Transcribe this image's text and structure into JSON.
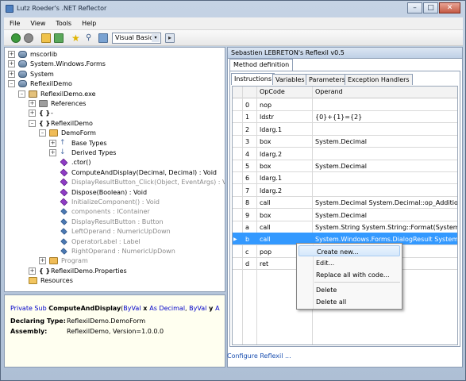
{
  "window": {
    "title": "Lutz Roeder's .NET Reflector",
    "min": "–",
    "max": "□",
    "close": "✕"
  },
  "menu": [
    "File",
    "View",
    "Tools",
    "Help"
  ],
  "toolbar": {
    "language": "Visual Basic",
    "go": "▸",
    "arrow": "▾"
  },
  "tree": [
    {
      "exp": "+",
      "icon": "asm",
      "label": "mscorlib",
      "gray": false
    },
    {
      "exp": "+",
      "icon": "asm",
      "label": "System.Windows.Forms",
      "gray": false
    },
    {
      "exp": "+",
      "icon": "asm",
      "label": "System",
      "gray": false
    },
    {
      "exp": "–",
      "icon": "asm",
      "label": "ReflexilDemo",
      "gray": false
    },
    {
      "exp": "–",
      "icon": "file",
      "label": "ReflexilDemo.exe",
      "gray": false
    },
    {
      "exp": "+",
      "icon": "refs",
      "label": "References",
      "gray": false
    },
    {
      "exp": "+",
      "icon": "ns",
      "label": "-",
      "gray": false
    },
    {
      "exp": "–",
      "icon": "ns",
      "label": "ReflexilDemo",
      "gray": false
    },
    {
      "exp": "–",
      "icon": "cls",
      "label": "DemoForm",
      "gray": false
    },
    {
      "exp": "+",
      "icon": "base",
      "label": "Base Types",
      "gray": false
    },
    {
      "exp": "+",
      "icon": "derived",
      "label": "Derived Types",
      "gray": false
    },
    {
      "exp": "",
      "icon": "method",
      "label": ".ctor()",
      "gray": false
    },
    {
      "exp": "",
      "icon": "method",
      "label": "ComputeAndDisplay(Decimal, Decimal) : Void",
      "gray": false
    },
    {
      "exp": "",
      "icon": "method",
      "label": "DisplayResultButton_Click(Object, EventArgs) : Void",
      "gray": true
    },
    {
      "exp": "",
      "icon": "method",
      "label": "Dispose(Boolean) : Void",
      "gray": false
    },
    {
      "exp": "",
      "icon": "method",
      "label": "InitializeComponent() : Void",
      "gray": true
    },
    {
      "exp": "",
      "icon": "field",
      "label": "components : IContainer",
      "gray": true
    },
    {
      "exp": "",
      "icon": "field",
      "label": "DisplayResultButton : Button",
      "gray": true
    },
    {
      "exp": "",
      "icon": "field",
      "label": "LeftOperand : NumericUpDown",
      "gray": true
    },
    {
      "exp": "",
      "icon": "field",
      "label": "OperatorLabel : Label",
      "gray": true
    },
    {
      "exp": "",
      "icon": "field",
      "label": "RightOperand : NumericUpDown",
      "gray": true
    },
    {
      "exp": "+",
      "icon": "cls",
      "label": "Program",
      "gray": true
    },
    {
      "exp": "+",
      "icon": "ns",
      "label": "ReflexilDemo.Properties",
      "gray": false
    },
    {
      "exp": "",
      "icon": "folder",
      "label": "Resources",
      "gray": false
    }
  ],
  "disasm": {
    "kw1": "Private Sub ",
    "name": "ComputeAndDisplay",
    "p1": "(",
    "kw2": "ByVal",
    "x": " x ",
    "kw3": "As Decimal",
    "sep": ", ",
    "kw4": "ByVal",
    "y": " y ",
    "kw5": "A",
    "declaring_label": "Declaring Type:",
    "declaring_value": "ReflexilDemo.DemoForm",
    "assembly_label": "Assembly:",
    "assembly_value": "ReflexilDemo, Version=1.0.0.0"
  },
  "reflexil": {
    "title": "Sebastien LEBRETON's Reflexil v0.5",
    "tab": "Method definition",
    "subtabs": [
      "Instructions",
      "Variables",
      "Parameters",
      "Exception Handlers"
    ],
    "columns": [
      "OpCode",
      "Operand"
    ],
    "rows": [
      {
        "idx": "0",
        "op": "nop",
        "arg": ""
      },
      {
        "idx": "1",
        "op": "ldstr",
        "arg": "{0}+{1}={2}"
      },
      {
        "idx": "2",
        "op": "ldarg.1",
        "arg": ""
      },
      {
        "idx": "3",
        "op": "box",
        "arg": "System.Decimal"
      },
      {
        "idx": "4",
        "op": "ldarg.2",
        "arg": ""
      },
      {
        "idx": "5",
        "op": "box",
        "arg": "System.Decimal"
      },
      {
        "idx": "6",
        "op": "ldarg.1",
        "arg": ""
      },
      {
        "idx": "7",
        "op": "ldarg.2",
        "arg": ""
      },
      {
        "idx": "8",
        "op": "call",
        "arg": "System.Decimal System.Decimal::op_Addition(..."
      },
      {
        "idx": "9",
        "op": "box",
        "arg": "System.Decimal"
      },
      {
        "idx": "a",
        "op": "call",
        "arg": "System.String System.String::Format(System.St..."
      },
      {
        "idx": "b",
        "op": "call",
        "arg": "System.Windows.Forms.DialogResult System...."
      },
      {
        "idx": "c",
        "op": "pop",
        "arg": ""
      },
      {
        "idx": "d",
        "op": "ret",
        "arg": ""
      }
    ],
    "selected_index": 11,
    "configure": "Configure Reflexil ..."
  },
  "context_menu": [
    "Create new...",
    "Edit...",
    "Replace all with code...",
    "Delete",
    "Delete all"
  ]
}
